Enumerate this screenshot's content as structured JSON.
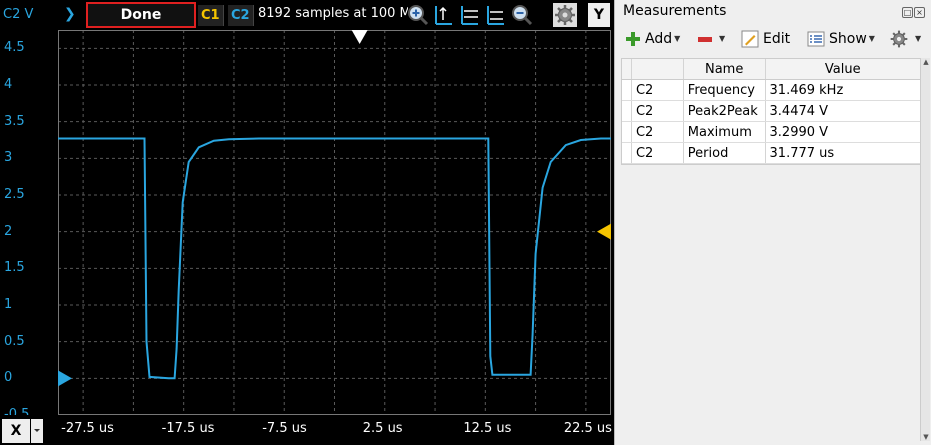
{
  "toolbar": {
    "y_axis_label": "C2 V",
    "play_icon": "play-icon",
    "status": "Done",
    "channel1": "C1",
    "channel2": "C2",
    "sample_info": "8192 samples at 100 M",
    "icons": [
      "zoom-in-icon",
      "cursor-vertical-icon",
      "cursor-horizontal-icon",
      "cursor-slope-icon",
      "zoom-out-icon",
      "gear-icon"
    ],
    "y_button": "Y"
  },
  "y_ticks": [
    "4.5",
    "4",
    "3.5",
    "3",
    "2.5",
    "2",
    "1.5",
    "1",
    "0.5",
    "0",
    "-0.5"
  ],
  "x_axis": {
    "button": "X",
    "ticks": [
      "-27.5 us",
      "-17.5 us",
      "-7.5 us",
      "2.5 us",
      "12.5 us",
      "22.5 us"
    ]
  },
  "colors": {
    "channel1": "#f5c400",
    "channel2": "#2aa6e0",
    "grid": "#5a5a5a",
    "status_border": "#e02020"
  },
  "chart_data": {
    "type": "line",
    "xlabel": "",
    "ylabel": "C2 V",
    "xlim": [
      -30,
      25
    ],
    "ylim": [
      -0.5,
      4.75
    ],
    "grid": true,
    "series": [
      {
        "color": "#2aa6e0",
        "x": [
          -30,
          -21.4,
          -21.2,
          -20.9,
          -19,
          -18.4,
          -18.2,
          -18.0,
          -17.6,
          -17.0,
          -16.0,
          -14.5,
          -13,
          -10,
          0,
          12.8,
          13.0,
          13.2,
          17.0,
          17.2,
          17.5,
          18.2,
          19.0,
          20.5,
          22,
          24,
          25
        ],
        "y": [
          3.27,
          3.27,
          0.5,
          0.02,
          0.0,
          0.0,
          0.4,
          1.2,
          2.4,
          2.95,
          3.15,
          3.24,
          3.26,
          3.27,
          3.27,
          3.27,
          0.3,
          0.05,
          0.05,
          0.6,
          1.7,
          2.6,
          2.95,
          3.18,
          3.25,
          3.27,
          3.27
        ]
      }
    ],
    "markers": {
      "trigger_time": 0,
      "trigger_level": 2.0,
      "ground_level": 0
    }
  },
  "panel": {
    "title": "Measurements",
    "tools": {
      "add": "Add",
      "remove_icon": "minus-icon",
      "edit": "Edit",
      "show": "Show",
      "settings_icon": "gear-icon"
    },
    "headers": [
      "Name",
      "Value"
    ],
    "rows": [
      {
        "channel": "C2",
        "name": "Frequency",
        "value": "31.469 kHz"
      },
      {
        "channel": "C2",
        "name": "Peak2Peak",
        "value": "3.4474 V"
      },
      {
        "channel": "C2",
        "name": "Maximum",
        "value": "3.2990 V"
      },
      {
        "channel": "C2",
        "name": "Period",
        "value": "31.777 us"
      }
    ]
  }
}
